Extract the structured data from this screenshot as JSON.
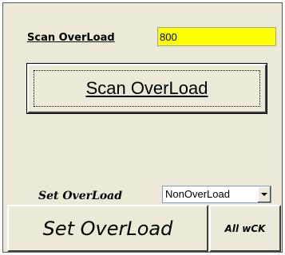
{
  "scan": {
    "label": "Scan OverLoad",
    "value": "800",
    "button_label": "Scan OverLoad"
  },
  "set": {
    "label": "Set OverLoad",
    "selected_option": "NonOverLoad",
    "button_label": "Set OverLoad",
    "all_button_label": "All wCK"
  },
  "colors": {
    "panel_bg": "#ece9d8",
    "input_highlight": "#ffff00"
  }
}
